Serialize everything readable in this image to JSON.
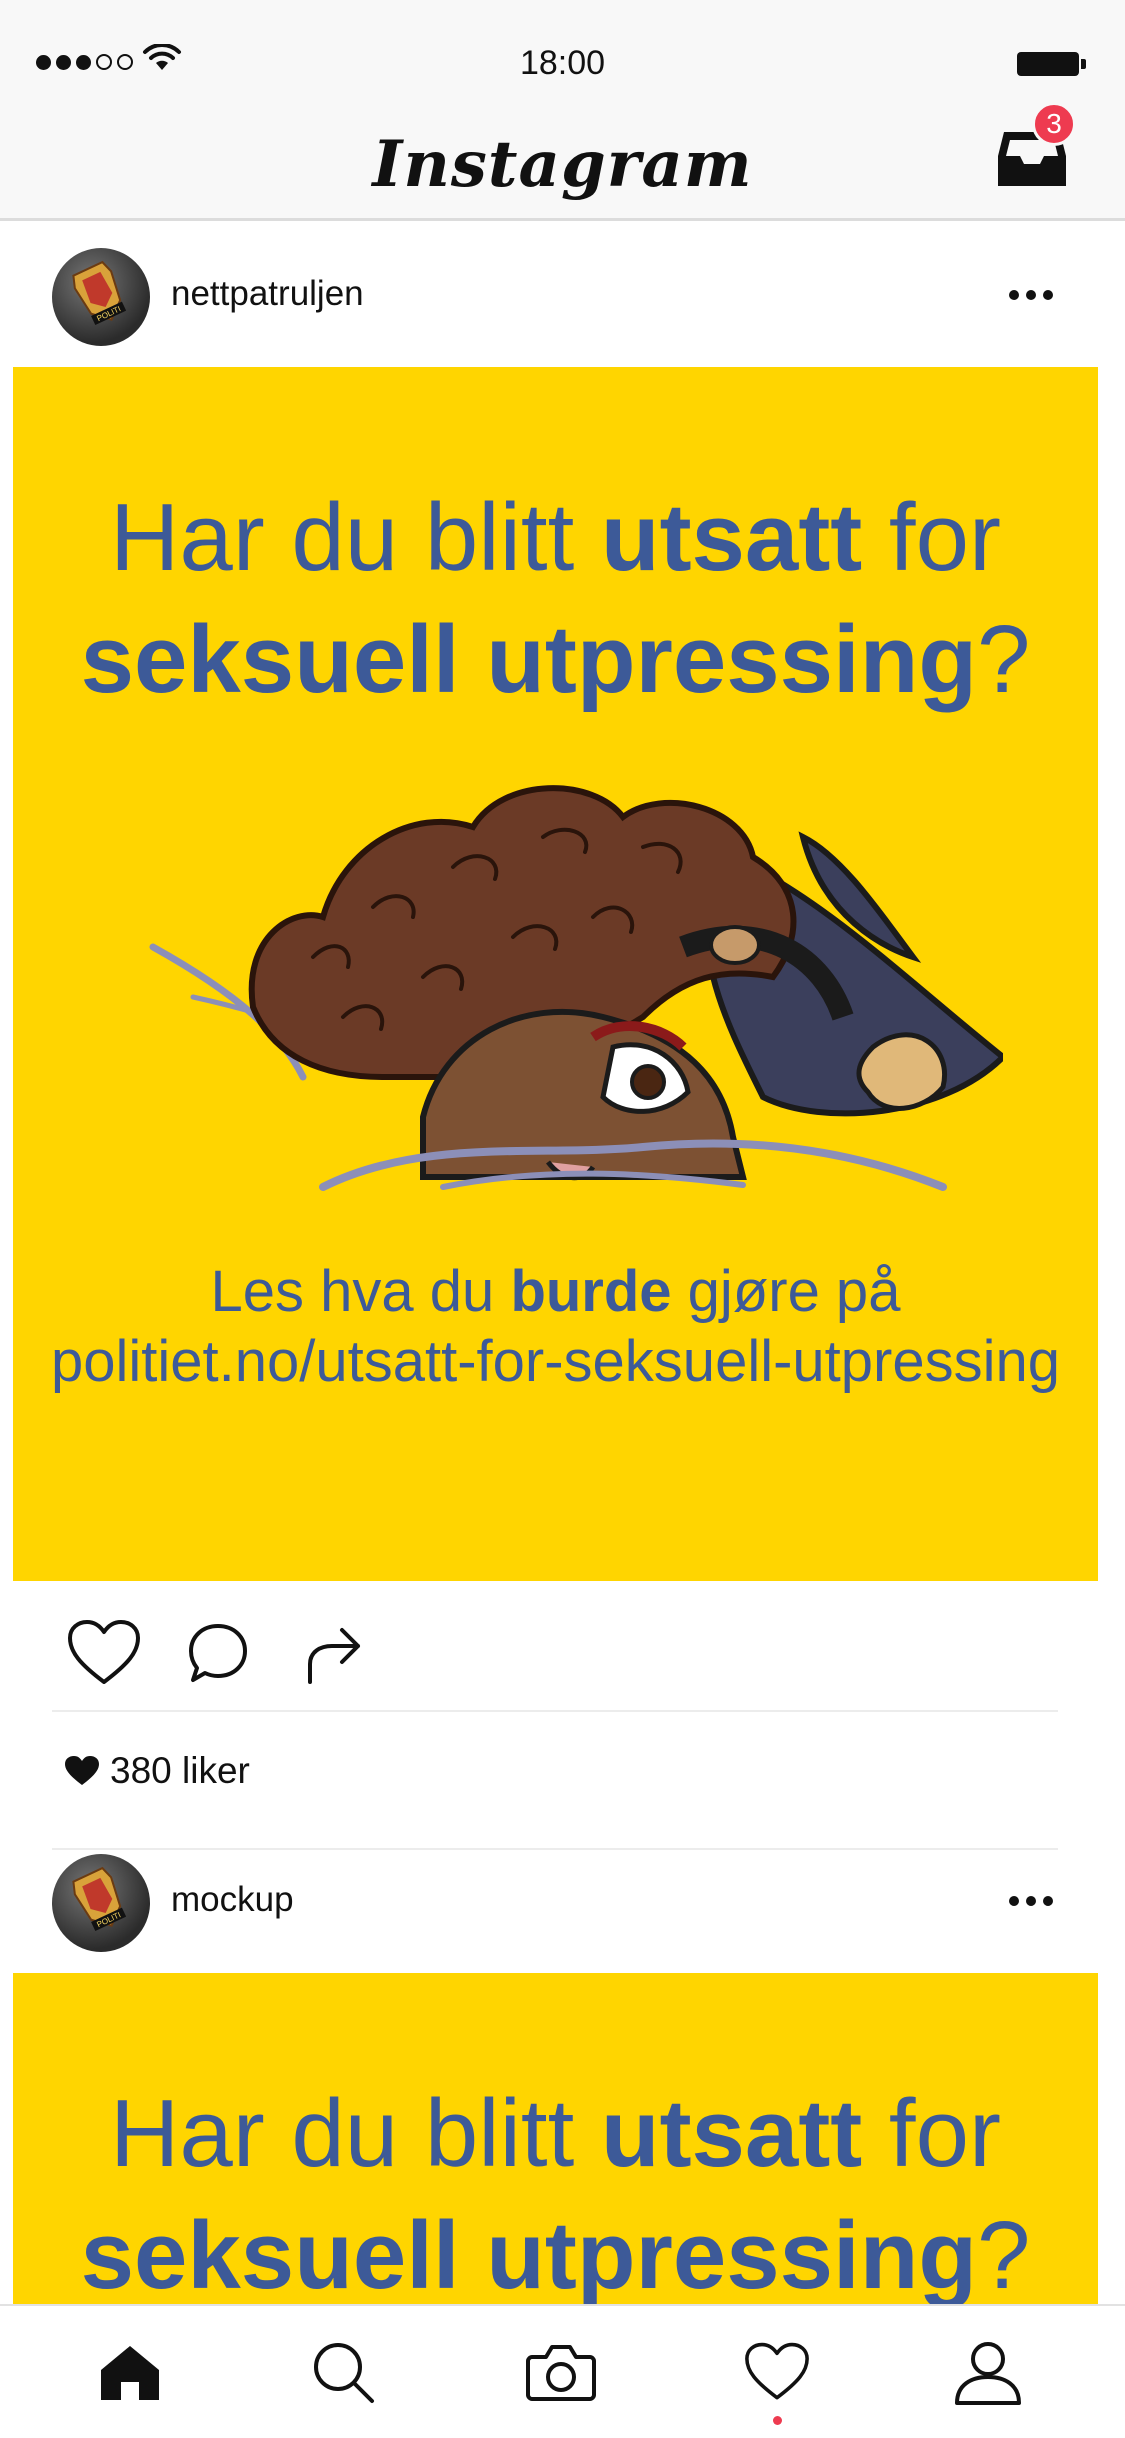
{
  "status_bar": {
    "time": "18:00"
  },
  "header": {
    "app_title": "Instagram",
    "inbox_badge": "3"
  },
  "posts": [
    {
      "username": "nettpatruljen",
      "headline_line1_pre": "Har du blitt ",
      "headline_line1_bold": "utsatt",
      "headline_line1_post": " for",
      "headline_line2_bold": "seksuell utpressing",
      "headline_line2_post": "?",
      "cta_pre": "Les hva du ",
      "cta_bold": "burde",
      "cta_post": " gjøre på",
      "cta_url": "politiet.no/utsatt-for-seksuell-utpressing",
      "likes": "380 liker",
      "avatar_text": "POLITI"
    },
    {
      "username": "mockup",
      "headline_line1_pre": "Har du blitt ",
      "headline_line1_bold": "utsatt",
      "headline_line1_post": " for",
      "headline_line2_bold": "seksuell utpressing",
      "headline_line2_post": "?",
      "avatar_text": "POLITI"
    }
  ],
  "tab_bar": {
    "tabs": [
      "home-icon",
      "search-icon",
      "camera-icon",
      "heart-icon",
      "profile-icon"
    ],
    "active_tab": "home-icon",
    "notification_tab": "heart-icon"
  },
  "colors": {
    "post_background": "#ffd500",
    "headline_text": "#3d5a98",
    "badge": "#ee3b50"
  }
}
